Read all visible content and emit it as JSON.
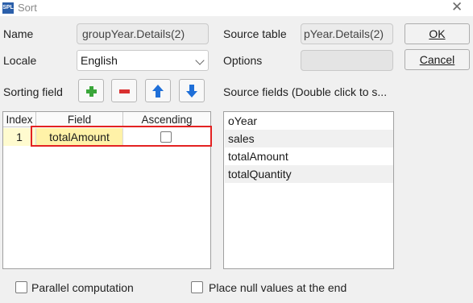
{
  "window": {
    "title": "Sort",
    "app_icon": "SPL"
  },
  "form": {
    "name_label": "Name",
    "name_value": "groupYear.Details(2)",
    "locale_label": "Locale",
    "locale_value": "English",
    "source_table_label": "Source table",
    "source_table_value": "pYear.Details(2)",
    "options_label": "Options",
    "options_value": "",
    "sorting_field_label": "Sorting field",
    "source_fields_label": "Source fields (Double click to s..."
  },
  "buttons": {
    "ok": "OK",
    "cancel": "Cancel"
  },
  "icons": {
    "add": "plus-icon",
    "remove": "minus-icon",
    "up": "arrow-up-icon",
    "down": "arrow-down-icon"
  },
  "colors": {
    "add": "#3aa63a",
    "remove": "#d93030",
    "arrows": "#1f6fd8",
    "selection": "#fff2a8",
    "highlight": "#e32222"
  },
  "sort_table": {
    "headers": [
      "Index",
      "Field",
      "Ascending"
    ],
    "rows": [
      {
        "index": "1",
        "field": "totalAmount",
        "ascending": false
      }
    ]
  },
  "source_fields": [
    "oYear",
    "sales",
    "totalAmount",
    "totalQuantity"
  ],
  "bottom": {
    "parallel_label": "Parallel computation",
    "parallel_checked": false,
    "null_label": "Place null values at the end",
    "null_checked": false
  }
}
